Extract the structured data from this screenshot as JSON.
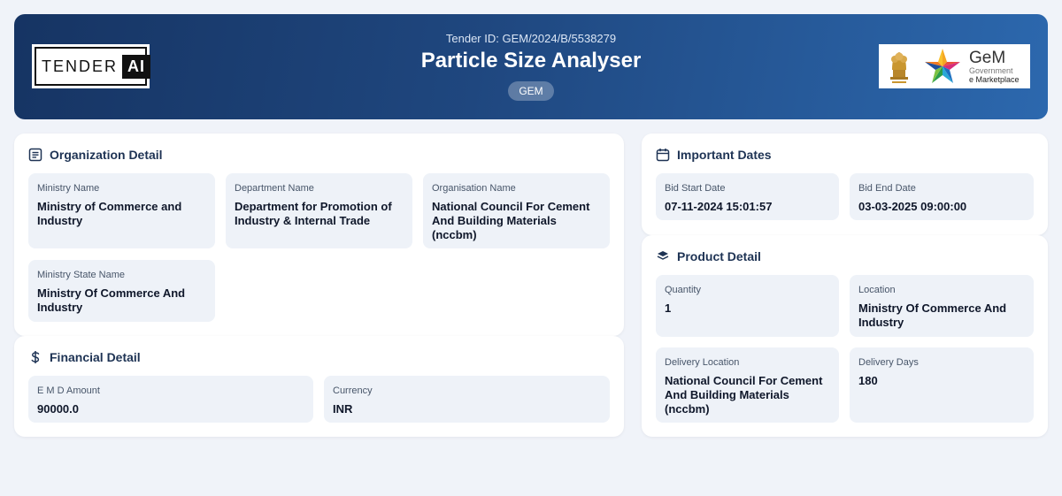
{
  "header": {
    "tender_id": "Tender ID: GEM/2024/B/5538279",
    "title": "Particle Size Analyser",
    "badge": "GEM",
    "logo_left": {
      "word": "TENDER",
      "ai": "AI"
    },
    "logo_right": {
      "word": "GeM",
      "sub": "Government",
      "sub2": "e Marketplace"
    }
  },
  "organization": {
    "title": "Organization Detail",
    "icon": "document-list-icon",
    "fields": [
      {
        "label": "Ministry Name",
        "value": "Ministry of Commerce and Industry"
      },
      {
        "label": "Department Name",
        "value": "Department for Promotion of Industry & Internal Trade"
      },
      {
        "label": "Organisation Name",
        "value": "National Council For Cement And Building Materials (nccbm)"
      },
      {
        "label": "Ministry State Name",
        "value": "Ministry Of Commerce And Industry"
      }
    ]
  },
  "financial": {
    "title": "Financial Detail",
    "icon": "dollar-icon",
    "fields": [
      {
        "label": "E M D Amount",
        "value": "90000.0"
      },
      {
        "label": "Currency",
        "value": "INR"
      }
    ]
  },
  "dates": {
    "title": "Important Dates",
    "icon": "calendar-icon",
    "fields": [
      {
        "label": "Bid Start Date",
        "value": "07-11-2024 15:01:57"
      },
      {
        "label": "Bid End Date",
        "value": "03-03-2025 09:00:00"
      }
    ]
  },
  "product": {
    "title": "Product Detail",
    "icon": "layers-icon",
    "fields": [
      {
        "label": "Quantity",
        "value": "1"
      },
      {
        "label": "Location",
        "value": "Ministry Of Commerce And Industry"
      },
      {
        "label": "Delivery Location",
        "value": "National Council For Cement And Building Materials (nccbm)"
      },
      {
        "label": "Delivery Days",
        "value": "180"
      }
    ]
  },
  "colors": {
    "header_start": "#163463",
    "header_end": "#2c68ae",
    "background": "#f0f3f9",
    "field_bg": "#eef2f8"
  }
}
